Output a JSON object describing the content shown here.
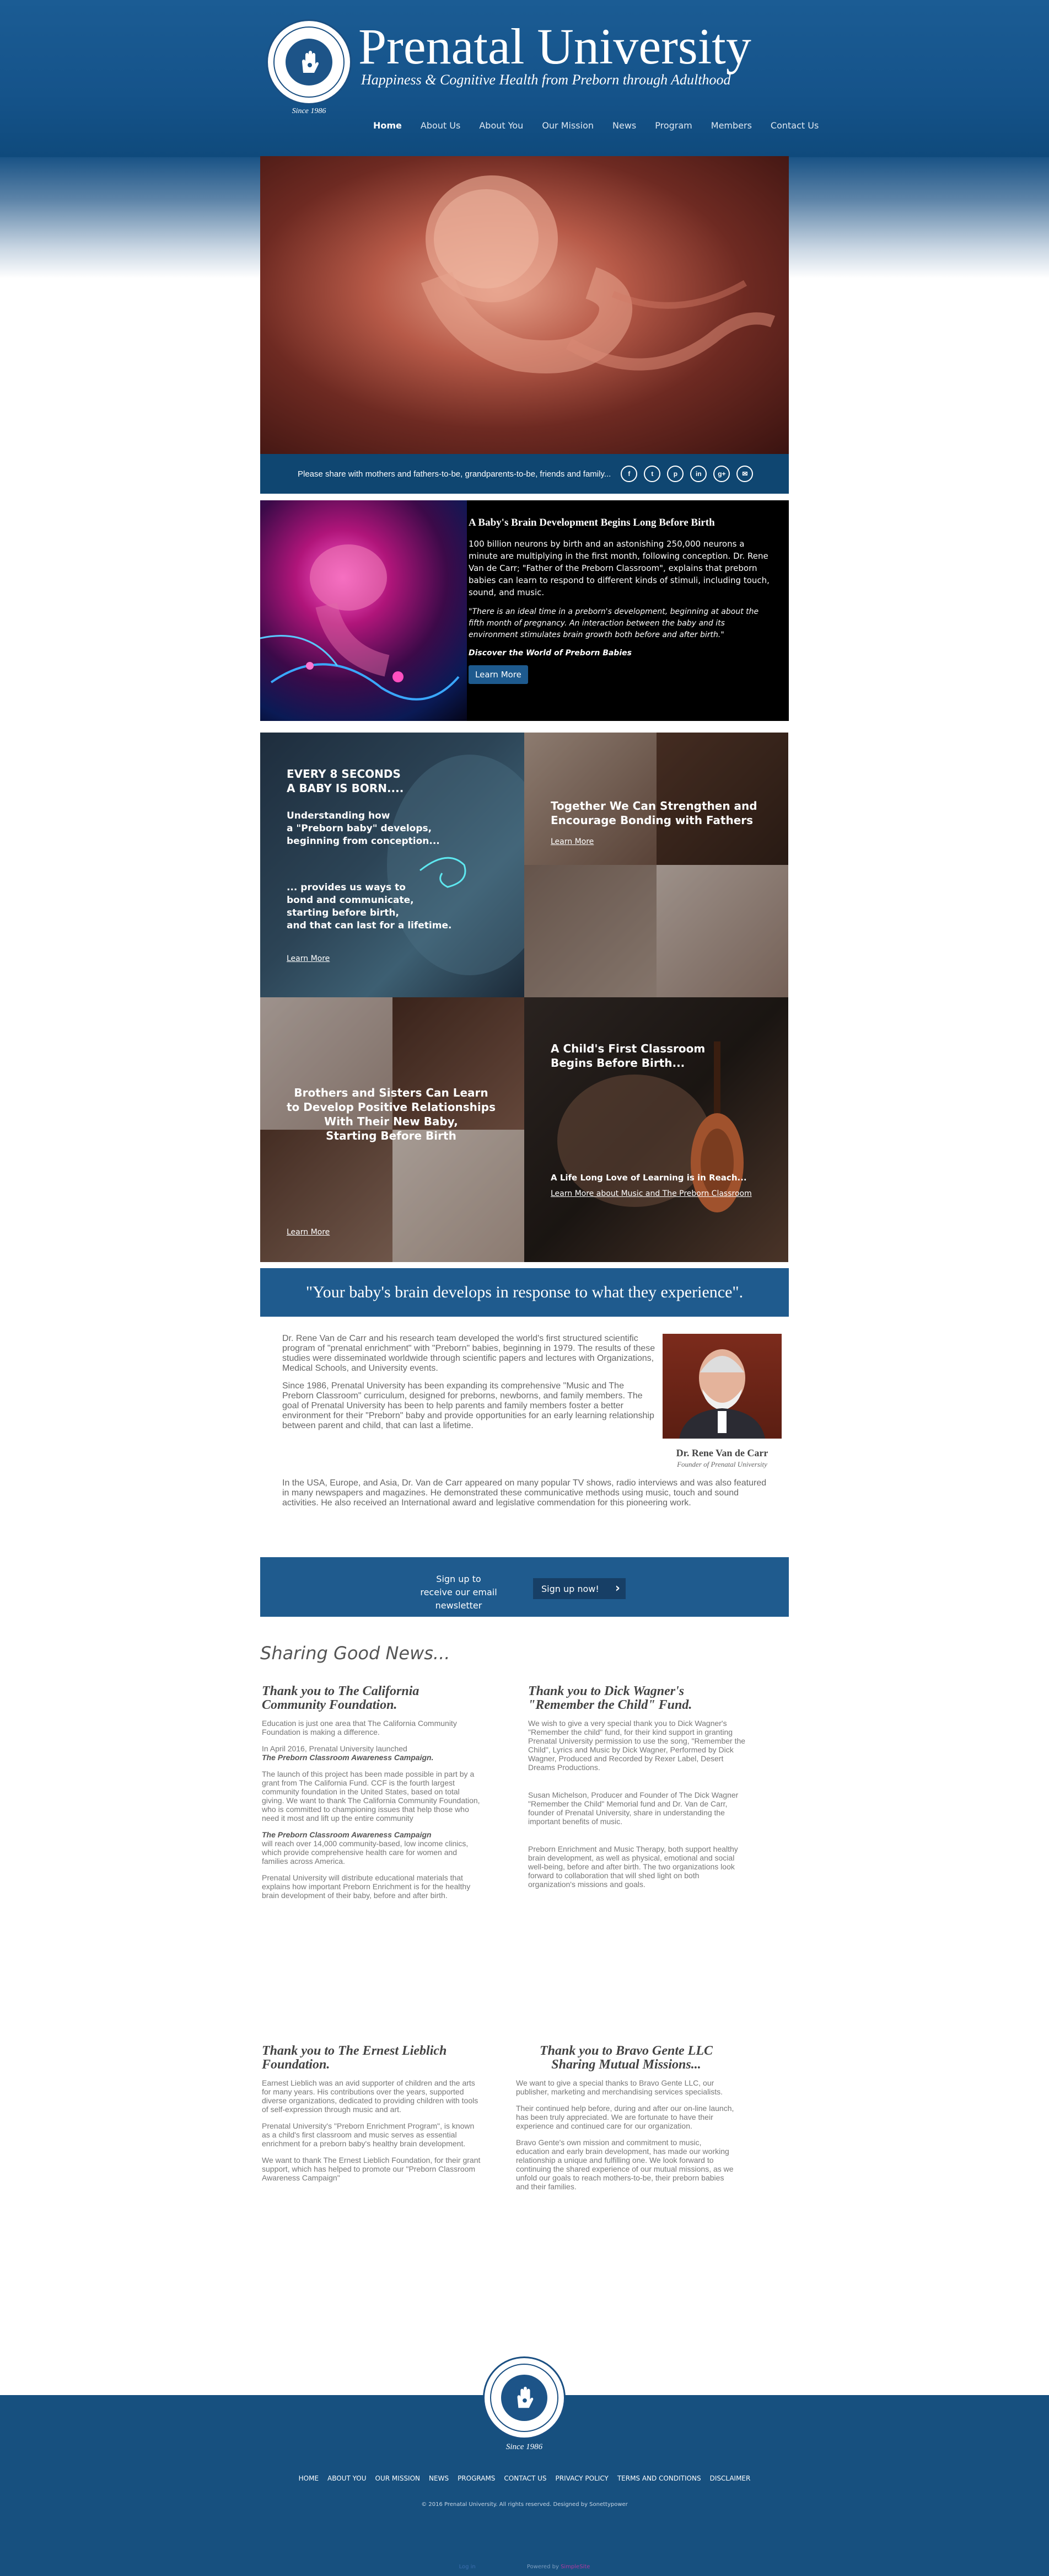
{
  "header": {
    "title": "Prenatal University",
    "tagline": "Happiness & Cognitive Health from Preborn through Adulthood",
    "since": "Since 1986"
  },
  "nav": [
    "Home",
    "About Us",
    "About You",
    "Our Mission",
    "News",
    "Program",
    "Members",
    "Contact Us"
  ],
  "share": {
    "text": "Please share with mothers and fathers-to-be, grandparents-to-be, friends and family...",
    "icons": [
      "facebook-icon",
      "twitter-icon",
      "pinterest-icon",
      "linkedin-icon",
      "google-plus-icon",
      "email-icon"
    ]
  },
  "brain": {
    "title": "A Baby's Brain Development Begins Long Before Birth",
    "paragraph": "100 billion neurons by birth and an astonishing 250,000 neurons a minute are multiplying in the first month, following conception. Dr. Rene Van de Carr; \"Father of the Preborn Classroom\", explains that preborn babies can learn to respond to different kinds of stimuli, including touch, sound, and music.",
    "quote": "\"There is an ideal time in a preborn's development, beginning at about the fifth month of pregnancy. An interaction between the baby and its environment stimulates brain growth both before and after birth.\"",
    "link": "Discover the World of Preborn Babies",
    "button": "Learn More"
  },
  "tiles": {
    "t1": {
      "heading": "EVERY 8 SECONDS\nA BABY IS BORN....",
      "sub1": "Understanding how\na \"Preborn baby\" develops,\nbeginning from conception...",
      "sub2": "... provides us ways to\nbond and communicate,\nstarting before birth,\nand that can last for a lifetime.",
      "link": "Learn More"
    },
    "t2": {
      "heading": "Together We Can Strengthen and\nEncourage Bonding with Fathers",
      "link": "Learn More"
    },
    "t3": {
      "heading": "Brothers and Sisters Can Learn\nto Develop Positive Relationships\nWith Their New Baby,\nStarting Before Birth",
      "link": "Learn More"
    },
    "t4": {
      "heading": "A Child's First Classroom\nBegins Before Birth...",
      "sub": "A Life Long Love of Learning is in Reach...",
      "link": "Learn More about Music and The Preborn Classroom"
    }
  },
  "quote": "\"Your baby's brain develops in response to what they experience\".",
  "about": {
    "p1": "Dr. Rene Van de Carr and his research team developed the world's first structured scientific program of \"prenatal enrichment\" with \"Preborn\" babies, beginning in 1979. The results of these studies were disseminated worldwide through scientific papers and lectures with Organizations, Medical Schools, and University events.",
    "p2": "Since 1986, Prenatal University has been expanding its comprehensive \"Music and The Preborn Classroom\" curriculum, designed for preborns, newborns, and family members. The goal of Prenatal University has been to help parents and family members foster a better environment for their \"Preborn\" baby and provide opportunities for an early learning relationship between parent and child, that can last a lifetime.",
    "p3": "In the USA, Europe, and Asia, Dr. Van de Carr appeared on many popular TV shows, radio interviews and was also featured in many newspapers and magazines. He demonstrated these communicative methods using music, touch and sound activities.  He also received an International award and legislative commendation for this pioneering work.",
    "name": "Dr. Rene Van de Carr",
    "role": "Founder of Prenatal University"
  },
  "signup": {
    "text": "Sign up to receive our email newsletter",
    "button": "Sign up now!"
  },
  "news": {
    "title": "Sharing Good News...",
    "n1": {
      "heading": "Thank you to The California Community Foundation.",
      "p1": "Education is just one area that The California Community Foundation is making a difference.",
      "p2a": "In April 2016, Prenatal University launched",
      "p2b": "The Preborn Classroom Awareness Campaign.",
      "p3": "The launch of this project has been made possible in part by a grant from The California Fund. CCF is the fourth largest community foundation in the United States, based on total giving. We want to thank The California Community Foundation, who is committed to championing issues that help those who need it most and lift up the entire community",
      "p4a": "The Preborn Classroom Awareness Campaign",
      "p4b": "will reach over 14,000 community-based, low income clinics, which provide comprehensive health care for women and families across America.",
      "p5": "Prenatal University will distribute educational materials that explains how important Preborn Enrichment is for the healthy brain development of their baby, before and after birth."
    },
    "n2": {
      "heading": "Thank you to Dick Wagner's \"Remember the Child\" Fund.",
      "p1": "We wish to give a very special thank you to Dick Wagner's \"Remember the child\" fund, for their kind support in granting Prenatal University permission to use the song, \"Remember the Child\", Lyrics and Music by Dick Wagner, Performed by Dick Wagner, Produced and Recorded by Rexer Label, Desert Dreams Productions.",
      "p2": "Susan Michelson, Producer and Founder of The Dick Wagner \"Remember the Child\" Memorial fund and Dr. Van de Carr, founder of Prenatal University, share in understanding the important benefits of music.",
      "p3": "Preborn Enrichment and Music Therapy, both support healthy brain development, as well as physical, emotional and social well-being, before and after birth. The two organizations look forward to collaboration that will shed light on both organization's missions and goals."
    },
    "n3": {
      "heading": "Thank you to The Ernest Lieblich Foundation.",
      "p1": "Earnest Lieblich was an avid supporter of children and the arts for many years. His contributions over the years, supported diverse organizations, dedicated to providing children with tools of self-expression through music and art.",
      "p2": "Prenatal University's \"Preborn Enrichment Program\", is known as a child's first classroom and music serves as essential enrichment for a preborn baby's healthy brain development.",
      "p3": "We want to thank The Ernest Lieblich Foundation, for their grant support, which has helped to promote our \"Preborn Classroom Awareness Campaign\""
    },
    "n4": {
      "heading": "Thank you to Bravo Gente LLC Sharing Mutual Missions...",
      "p1": "We want to give a special thanks to Bravo Gente LLC, our publisher, marketing and merchandising services specialists.",
      "p2": "Their continued help before, during and after our on-line launch, has been truly appreciated. We are fortunate to have their experience and continued care for our organization.",
      "p3": "Bravo Gente's own mission and commitment to music, education and early brain development, has made our working relationship a unique and fulfilling one. We look forward to continuing the shared experience of our mutual missions, as we unfold our goals to reach mothers-to-be, their preborn babies and their families."
    }
  },
  "footer": {
    "since": "Since 1986",
    "links": [
      "HOME",
      "ABOUT YOU",
      "OUR MISSION",
      "NEWS",
      "PROGRAMS",
      "CONTACT US",
      "PRIVACY POLICY",
      "TERMS AND CONDITIONS",
      "DISCLAIMER"
    ],
    "copyright": "© 2016 Prenatal University. All rights reserved. Designed by Sonettypower",
    "login": "Log in",
    "powered": "Powered by",
    "powered_brand": "SimpleSite"
  },
  "colors": {
    "brand_blue": "#1b5c94",
    "dark_band": "#0f4671",
    "accent_blue": "#1f5b8e"
  }
}
